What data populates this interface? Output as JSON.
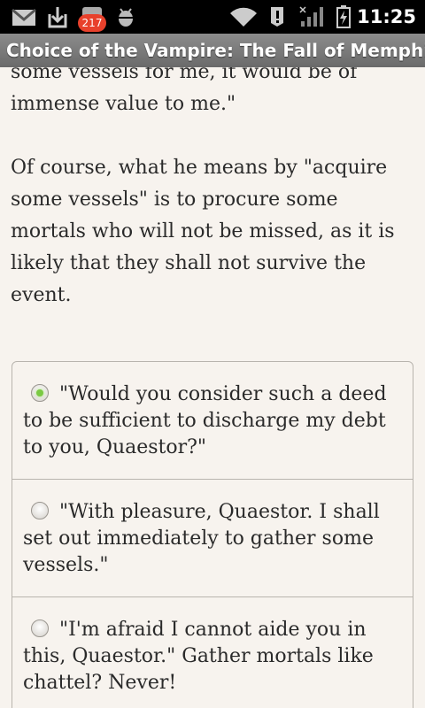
{
  "status_bar": {
    "time": "11:25",
    "notification_count": "217",
    "icons": [
      "gmail-icon",
      "download-icon",
      "notification-icon",
      "android-debug-icon",
      "wifi-icon",
      "alert-icon",
      "signal-icon",
      "battery-charging-icon"
    ]
  },
  "app": {
    "title": "Choice of the Vampire: The Fall of Memphis"
  },
  "story": {
    "partial_line": "some vessels for me, it would be of immense value to me.\"",
    "paragraph": "Of course, what he means by \"acquire some vessels\" is to procure some mortals who will not be missed, as it is likely that they shall not survive the event."
  },
  "choices": [
    {
      "label": "\"Would you consider such a deed to be sufficient to discharge my debt to you, Quaestor?\"",
      "selected": true
    },
    {
      "label": "\"With pleasure, Quaestor. I shall set out immediately to gather some vessels.\"",
      "selected": false
    },
    {
      "label": "\"I'm afraid I cannot aide you in this, Quaestor.\" Gather mortals like chattel? Never!",
      "selected": false
    }
  ],
  "colors": {
    "status_bar": "#000000",
    "title_bar": "#7a7a7a",
    "background": "#f7f3ee",
    "badge": "#e8412c",
    "radio_selected": "#7ac943"
  }
}
